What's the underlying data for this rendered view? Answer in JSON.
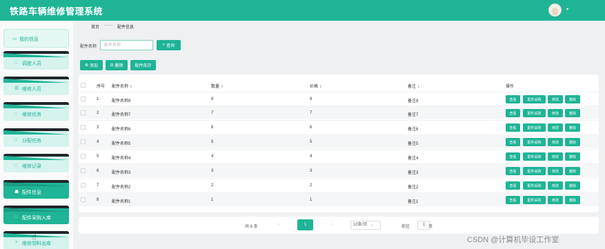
{
  "header": {
    "title": "铁路车辆维修管理系统",
    "avatar_caret": "▾"
  },
  "sidebar": {
    "items": [
      {
        "label": "我的信息",
        "icon": "▭"
      },
      {
        "label": "调度人员",
        "icon": "∷"
      },
      {
        "label": "维修人员",
        "icon": "☰"
      },
      {
        "label": "维修任务",
        "icon": "∷"
      },
      {
        "label": "分配任务",
        "icon": "∷"
      },
      {
        "label": "维修记录",
        "icon": "∷"
      },
      {
        "label": "配件信息",
        "icon": "☗"
      },
      {
        "label": "配件采购入库",
        "icon": "∷"
      },
      {
        "label": "维修领料出库",
        "icon": "♆"
      }
    ],
    "active_index": 6
  },
  "breadcrumb": {
    "home": "首页",
    "separator": "——",
    "current": "配件信息"
  },
  "search": {
    "label": "配件名称",
    "placeholder": "配件名称",
    "value": "",
    "button_label": "查询",
    "button_icon": "⌕"
  },
  "toolbar": {
    "add_label": "添加",
    "add_icon": "⊕",
    "delete_label": "删除",
    "delete_icon": "⊟",
    "stock_label": "配件库存"
  },
  "table": {
    "headers": {
      "index": "序号",
      "name": "配件名称",
      "qty": "数量",
      "price": "价格",
      "note": "备注",
      "ops": "操作",
      "sort_icon": "⇕"
    },
    "actions": [
      "查看",
      "配件采购",
      "修改",
      "删除"
    ],
    "rows": [
      {
        "index": "1",
        "name": "配件名称8",
        "qty": "8",
        "price": "8",
        "note": "备注8"
      },
      {
        "index": "2",
        "name": "配件名称7",
        "qty": "7",
        "price": "7",
        "note": "备注7"
      },
      {
        "index": "3",
        "name": "配件名称6",
        "qty": "6",
        "price": "6",
        "note": "备注6"
      },
      {
        "index": "4",
        "name": "配件名称5",
        "qty": "5",
        "price": "5",
        "note": "备注5"
      },
      {
        "index": "5",
        "name": "配件名称4",
        "qty": "4",
        "price": "4",
        "note": "备注4"
      },
      {
        "index": "6",
        "name": "配件名称3",
        "qty": "3",
        "price": "3",
        "note": "备注3"
      },
      {
        "index": "7",
        "name": "配件名称2",
        "qty": "2",
        "price": "2",
        "note": "备注2"
      },
      {
        "index": "8",
        "name": "配件名称1",
        "qty": "1",
        "price": "1",
        "note": "备注1"
      }
    ]
  },
  "pagination": {
    "total": "共 8 条",
    "prev": "‹",
    "current_page": "1",
    "next": "›",
    "page_size": "10条/页",
    "page_size_caret": "⌄",
    "goto_label": "前往",
    "goto_value": "1",
    "page_suffix": "页"
  },
  "watermark": "CSDN @计算机毕设工作室",
  "colors": {
    "primary": "#1fb496",
    "sidebar_card": "#d6f3ee",
    "dark_cap": "#1f2529"
  }
}
